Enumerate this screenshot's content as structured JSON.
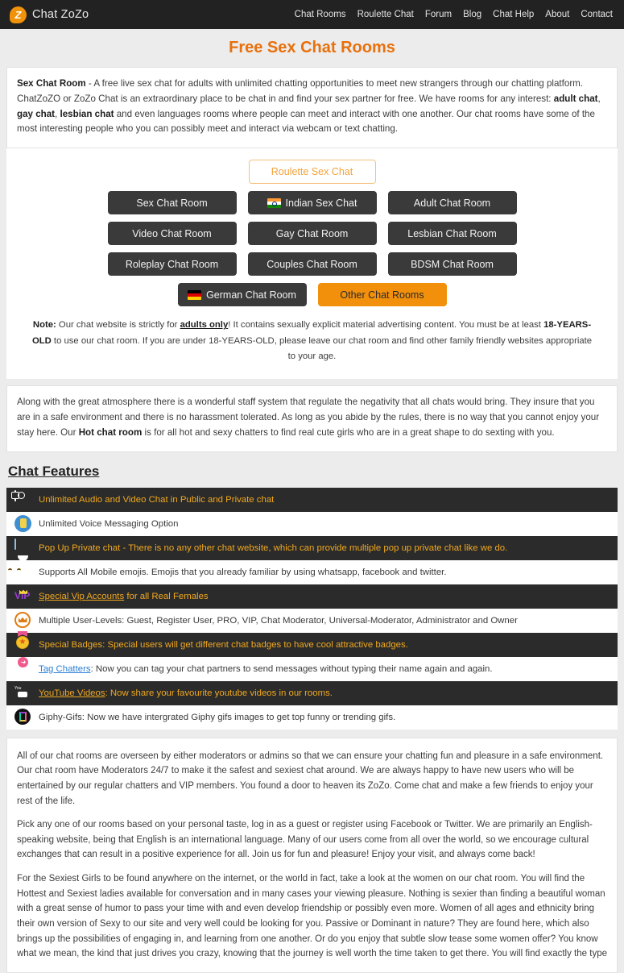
{
  "navbar": {
    "brand": "Chat ZoZo",
    "logo_letter": "Z",
    "links": [
      "Chat Rooms",
      "Roulette Chat",
      "Forum",
      "Blog",
      "Chat Help",
      "About",
      "Contact"
    ]
  },
  "page_title": "Free Sex Chat Rooms",
  "intro": {
    "lead": "Sex Chat Room",
    "t1": " - A free live sex chat for adults with unlimited chatting opportunities to meet new strangers through our chatting platform. ChatZoZO or ZoZo Chat is an extraordinary place to be chat in and find your sex partner for free. We have rooms for any interest: ",
    "b1": "adult chat",
    "t2": ", ",
    "b2": "gay chat",
    "t3": ", ",
    "b3": "lesbian chat",
    "t4": " and even languages rooms where people can meet and interact with one another. Our chat rooms have some of the most interesting people who you can possibly meet and interact via webcam or text chatting."
  },
  "rooms": {
    "roulette": "Roulette Sex Chat",
    "row1": [
      {
        "label": "Sex Chat Room",
        "flag": ""
      },
      {
        "label": "Indian Sex Chat",
        "flag": "india"
      },
      {
        "label": "Adult Chat Room",
        "flag": ""
      }
    ],
    "row2": [
      {
        "label": "Video Chat Room",
        "flag": ""
      },
      {
        "label": "Gay Chat Room",
        "flag": ""
      },
      {
        "label": "Lesbian Chat Room",
        "flag": ""
      }
    ],
    "row3": [
      {
        "label": "Roleplay Chat Room",
        "flag": ""
      },
      {
        "label": "Couples Chat Room",
        "flag": ""
      },
      {
        "label": "BDSM Chat Room",
        "flag": ""
      }
    ],
    "german": "German Chat Room",
    "other": "Other Chat Rooms"
  },
  "note": {
    "label": "Note:",
    "t1": " Our chat website is strictly for ",
    "u1": "adults only",
    "t2": "! It contains sexually explicit material advertising content. You must be at least ",
    "b1": "18-YEARS-OLD",
    "t3": " to use our chat room. If you are under 18-YEARS-OLD, please leave our chat room and find other family friendly websites appropriate to your age."
  },
  "staff": {
    "t1": "Along with the great atmosphere there is a wonderful staff system that regulate the negativity that all chats would bring. They insure that you are in a safe environment and there is no harassment tolerated. As long as you abide by the rules, there is no way that you cannot enjoy your stay here. Our ",
    "b1": "Hot chat room",
    "t2": " is for all hot and sexy chatters to find real cute girls who are in a great shape to do sexting with you."
  },
  "features_title": "Chat Features",
  "features": [
    {
      "icon": "video-chat-icon",
      "theme": "dark",
      "text": "Unlimited Audio and Video Chat in Public and Private chat",
      "link": ""
    },
    {
      "icon": "voice-message-icon",
      "theme": "light",
      "text": "Unlimited Voice Messaging Option",
      "link": ""
    },
    {
      "icon": "popup-window-icon",
      "theme": "dark",
      "text": "Pop Up Private chat - There is no any other chat website, which can provide multiple pop up private chat like we do.",
      "link": ""
    },
    {
      "icon": "emoji-smiley-icon",
      "theme": "light",
      "text": "Supports All Mobile emojis. Emojis that you already familiar by using whatsapp, facebook and twitter.",
      "link": ""
    },
    {
      "icon": "vip-crown-icon",
      "theme": "dark",
      "text": " for all Real Females",
      "link": "Special Vip Accounts"
    },
    {
      "icon": "crown-circle-icon",
      "theme": "light",
      "text": "Multiple User-Levels: Guest, Register User, PRO, VIP, Chat Moderator, Universal-Moderator, Administrator and Owner",
      "link": ""
    },
    {
      "icon": "badge-ribbon-icon",
      "theme": "dark",
      "text": "Special Badges: Special users will get different chat badges to have cool attractive badges.",
      "link": ""
    },
    {
      "icon": "tag-envelope-icon",
      "theme": "light",
      "text": ": Now you can tag your chat partners to send messages without typing their name again and again.",
      "link": "Tag Chatters"
    },
    {
      "icon": "youtube-icon",
      "theme": "dark",
      "text": ": Now share your favourite youtube videos in our rooms.",
      "link": "YouTube Videos"
    },
    {
      "icon": "giphy-icon",
      "theme": "light",
      "text": "Giphy-Gifs: Now we have intergrated Giphy gifs images to get top funny or trending gifs.",
      "link": ""
    }
  ],
  "bottom_paragraphs": [
    "All of our chat rooms are overseen by either moderators or admins so that we can ensure your chatting fun and pleasure in a safe environment. Our chat room have Moderators 24/7 to make it the safest and sexiest chat around. We are always happy to have new users who will be entertained by our regular chatters and VIP members. You found a door to heaven its ZoZo. Come chat and make a few friends to enjoy your rest of the life.",
    "Pick any one of our rooms based on your personal taste, log in as a guest or register using Facebook or Twitter. We are primarily an English-speaking website, being that English is an international language. Many of our users come from all over the world, so we encourage cultural exchanges that can result in a positive experience for all. Join us for fun and pleasure! Enjoy your visit, and always come back!",
    "For the Sexiest Girls to be found anywhere on the internet, or the world in fact, take a look at the women on our chat room. You will find the Hottest and Sexiest ladies available for conversation and in many cases your viewing pleasure. Nothing is sexier than finding a beautiful woman with a great sense of humor to pass your time with and even develop friendship or possibly even more. Women of all ages and ethnicity bring their own version of Sexy to our site and very well could be looking for you. Passive or Dominant in nature? They are found here, which also brings up the possibilities of engaging in, and learning from one another. Or do you enjoy that subtle slow tease some women offer? You know what we mean, the kind that just drives you crazy, knowing that the journey is well worth the time taken to get there. You will find exactly the type"
  ],
  "colors": {
    "accent_orange": "#e8700d",
    "button_orange": "#f2900c",
    "dark_row": "#2b2b2b",
    "dark_button": "#3a3a3a",
    "feature_text_orange": "#f0a81e"
  }
}
